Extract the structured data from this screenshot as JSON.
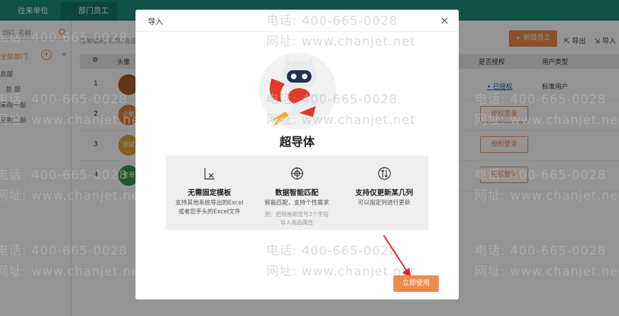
{
  "tabs": [
    {
      "label": "往来单位",
      "close": "×"
    },
    {
      "label": "部门员工",
      "close": "×"
    }
  ],
  "left": {
    "search_placeholder": "编码/名称",
    "head": "全部部门",
    "add": "+",
    "collapse": "«",
    "items": [
      "总部",
      "总 部",
      "采购一部",
      "采购二部"
    ]
  },
  "main": {
    "search_placeholder": "搜索编码/名称/电话",
    "add_label": "+ 新增员工",
    "export_label": "导出",
    "import_label": "导入",
    "columns": {
      "avatar": "头像",
      "auth": "是否授权",
      "utype": "用户类型"
    },
    "rows": [
      {
        "idx": "1",
        "avatar": "",
        "auth_text": "• 已授权",
        "utype": "标准用户"
      },
      {
        "idx": "2",
        "avatar": "企鹅",
        "auth_btn": "授权登录"
      },
      {
        "idx": "3",
        "avatar": "测试",
        "auth_btn": "授权登录"
      },
      {
        "idx": "4",
        "avatar": "宝哥",
        "auth_btn": "授权登录"
      }
    ]
  },
  "watermark": {
    "phone": "电话: 400-665-0028",
    "site": "网址: www.chanjet.net"
  },
  "modal": {
    "title": "导入",
    "close": "×",
    "brand": "超导体",
    "features": [
      {
        "icon": "template-icon",
        "title": "无需固定模板",
        "desc1": "支持其他系统导出的Excel",
        "desc2": "或者您手头的Excel文件"
      },
      {
        "icon": "target-icon",
        "title": "数据智能匹配",
        "desc1": "智能匹配，支持个性需求",
        "note1": "例：把规格和型号2个字段",
        "note2": "导入商品属性"
      },
      {
        "icon": "update-column-icon",
        "title": "支持仅更新某几列",
        "desc1": "可以指定列进行更新"
      }
    ],
    "use_button": "立即使用"
  },
  "colors": {
    "accent": "#f08a4b",
    "tabbar": "#1d8d7d",
    "arrow": "#e8231f"
  }
}
